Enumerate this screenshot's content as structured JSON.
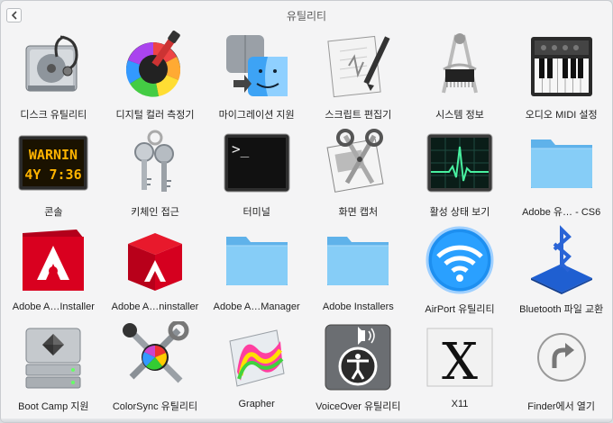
{
  "window": {
    "title": "유틸리티"
  },
  "apps": [
    {
      "label": "디스크 유틸리티",
      "icon": "disk-utility-icon"
    },
    {
      "label": "디지털 컬러 측정기",
      "icon": "digital-color-meter-icon"
    },
    {
      "label": "마이그레이션 지원",
      "icon": "migration-assistant-icon"
    },
    {
      "label": "스크립트 편집기",
      "icon": "script-editor-icon"
    },
    {
      "label": "시스템 정보",
      "icon": "system-information-icon"
    },
    {
      "label": "오디오 MIDI 설정",
      "icon": "audio-midi-setup-icon"
    },
    {
      "label": "콘솔",
      "icon": "console-icon",
      "screen_text": [
        "WARNIN",
        "4Y 7:36"
      ]
    },
    {
      "label": "키체인 접근",
      "icon": "keychain-access-icon"
    },
    {
      "label": "터미널",
      "icon": "terminal-icon",
      "screen_text": [
        ">_"
      ]
    },
    {
      "label": "화면 캡처",
      "icon": "grab-icon"
    },
    {
      "label": "활성 상태 보기",
      "icon": "activity-monitor-icon"
    },
    {
      "label": "Adobe 유… - CS6",
      "icon": "folder-icon"
    },
    {
      "label": "Adobe A…Installer",
      "icon": "adobe-air-installer-icon"
    },
    {
      "label": "Adobe A…ninstaller",
      "icon": "adobe-air-uninstaller-icon"
    },
    {
      "label": "Adobe A…Manager",
      "icon": "folder-icon"
    },
    {
      "label": "Adobe Installers",
      "icon": "folder-icon"
    },
    {
      "label": "AirPort 유틸리티",
      "icon": "airport-utility-icon"
    },
    {
      "label": "Bluetooth 파일 교환",
      "icon": "bluetooth-icon"
    },
    {
      "label": "Boot Camp 지원",
      "icon": "boot-camp-icon"
    },
    {
      "label": "ColorSync 유틸리티",
      "icon": "colorsync-icon"
    },
    {
      "label": "Grapher",
      "icon": "grapher-icon"
    },
    {
      "label": "VoiceOver 유틸리티",
      "icon": "voiceover-icon"
    },
    {
      "label": "X11",
      "icon": "x11-icon",
      "screen_text": [
        "X"
      ]
    },
    {
      "label": "Finder에서 열기",
      "icon": "open-in-finder-icon"
    }
  ]
}
